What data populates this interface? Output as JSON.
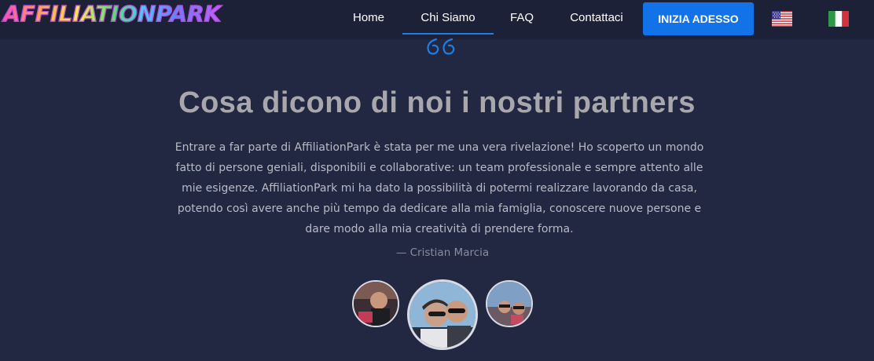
{
  "brand": {
    "logo_text": "AFFILIATIONPARK"
  },
  "nav": {
    "items": [
      {
        "label": "Home"
      },
      {
        "label": "Chi Siamo"
      },
      {
        "label": "FAQ"
      },
      {
        "label": "Contattaci"
      }
    ],
    "cta_label": "INIZIA ADESSO",
    "languages": [
      {
        "icon": "us-flag-icon"
      },
      {
        "icon": "italy-flag-icon"
      }
    ]
  },
  "section": {
    "quote_icon": "quote-icon",
    "title": "Cosa dicono di noi i nostri partners",
    "testimonial": "Entrare a far parte di AffiliationPark è stata per me una vera rivelazione! Ho scoperto un mondo fatto di persone geniali, disponibili e collaborative: un team professionale e sempre attento alle mie esigenze. AffiliationPark mi ha dato la possibilità di potermi realizzare lavorando da casa, potendo così avere anche più tempo da dedicare alla mia famiglia, conoscere nuove persone e dare modo alla mia creatività di prendere forma.",
    "author": "— Cristian Marcia"
  },
  "colors": {
    "background": "#222842",
    "navbar": "#1c2138",
    "accent": "#1272e8"
  }
}
